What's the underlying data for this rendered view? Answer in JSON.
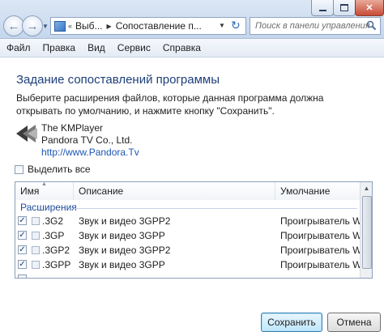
{
  "nav": {
    "address_parts": [
      "Выб...",
      "Сопоставление п..."
    ],
    "search_placeholder": "Поиск в панели управления"
  },
  "menu": [
    "Файл",
    "Правка",
    "Вид",
    "Сервис",
    "Справка"
  ],
  "page": {
    "title": "Задание сопоставлений программы",
    "description": "Выберите расширения файлов, которые данная программа должна открывать по умолчанию, и нажмите кнопку \"Сохранить\".",
    "program": {
      "name": "The KMPlayer",
      "company": "Pandora TV Co., Ltd.",
      "url": "http://www.Pandora.Tv"
    },
    "select_all": "Выделить все"
  },
  "table": {
    "columns": [
      "Имя",
      "Описание",
      "Умолчание"
    ],
    "group": "Расширения",
    "rows": [
      {
        "name": ".3G2",
        "description": "Звук и видео 3GPP2",
        "default": "Проигрыватель Windows",
        "checked": true
      },
      {
        "name": ".3GP",
        "description": "Звук и видео 3GPP",
        "default": "Проигрыватель Windows",
        "checked": true
      },
      {
        "name": ".3GP2",
        "description": "Звук и видео 3GPP2",
        "default": "Проигрыватель Windows",
        "checked": true
      },
      {
        "name": ".3GPP",
        "description": "Звук и видео 3GPP",
        "default": "Проигрыватель Windows",
        "checked": true
      }
    ]
  },
  "buttons": {
    "save": "Сохранить",
    "cancel": "Отмена"
  }
}
